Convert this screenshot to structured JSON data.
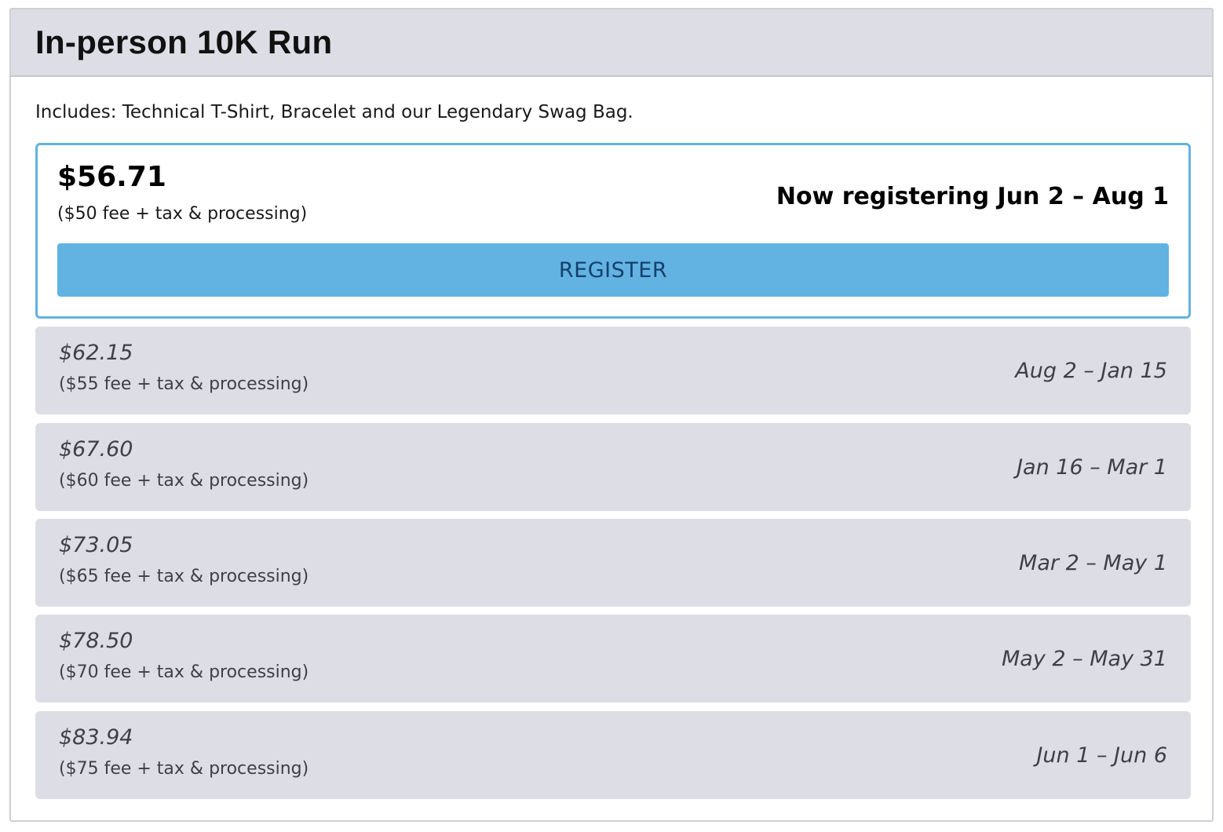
{
  "title": "In-person 10K Run",
  "includes": "Includes: Technical T-Shirt, Bracelet and our Legendary Swag Bag.",
  "active_tier": {
    "price": "$56.71",
    "subtitle": "($50 fee + tax & processing)",
    "dates": "Now registering Jun 2 – Aug 1",
    "button_label": "REGISTER"
  },
  "tiers": [
    {
      "price": "$62.15",
      "subtitle": "($55 fee + tax & processing)",
      "dates": "Aug 2 – Jan 15"
    },
    {
      "price": "$67.60",
      "subtitle": "($60 fee + tax & processing)",
      "dates": "Jan 16 – Mar 1"
    },
    {
      "price": "$73.05",
      "subtitle": "($65 fee + tax & processing)",
      "dates": "Mar 2 – May 1"
    },
    {
      "price": "$78.50",
      "subtitle": "($70 fee + tax & processing)",
      "dates": "May 2 – May 31"
    },
    {
      "price": "$83.94",
      "subtitle": "($75 fee + tax & processing)",
      "dates": "Jun 1 – Jun 6"
    }
  ],
  "colors": {
    "accent": "#62b3e2",
    "button_text": "#15406e",
    "header_bg": "#dddde6",
    "tier_bg": "#dddde6"
  }
}
